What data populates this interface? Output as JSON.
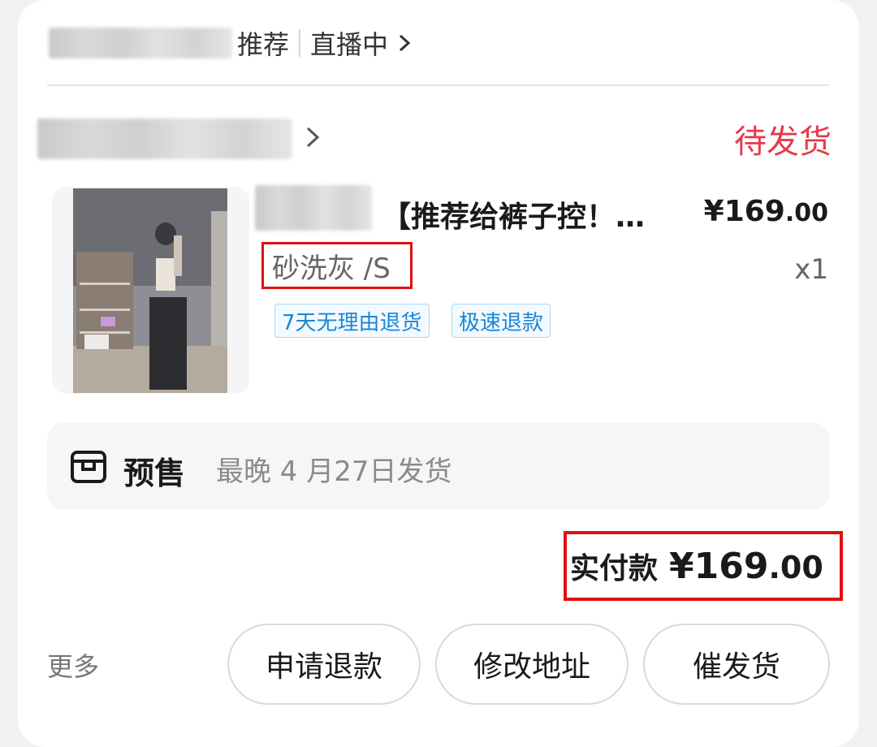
{
  "header": {
    "recommend_label": "推荐",
    "live_label": "直播中",
    "live_chevron": ">"
  },
  "store": {
    "chevron": ">",
    "status": "待发货"
  },
  "product": {
    "title": "【推荐给裤子控！…",
    "price_main": "¥169",
    "price_decimal": ".00",
    "variant": "砂洗灰 /S",
    "quantity": "x1",
    "tags": [
      "7天无理由退货",
      "极速退款"
    ]
  },
  "presale": {
    "icon": "box-icon",
    "title": "预售",
    "text": "最晚 4 月27日发货"
  },
  "payment": {
    "label": "实付款",
    "amount_main": "¥169",
    "amount_decimal": ".00"
  },
  "actions": {
    "more_label": "更多",
    "refund_label": "申请退款",
    "address_label": "修改地址",
    "urge_label": "催发货"
  },
  "colors": {
    "status": "#e8394a",
    "tag_text": "#1a86d6",
    "highlight_border": "#e01010"
  }
}
